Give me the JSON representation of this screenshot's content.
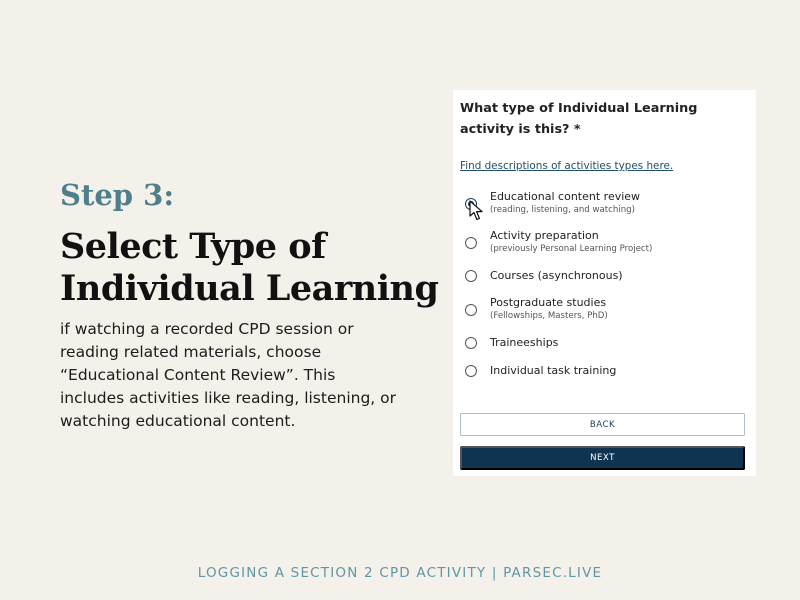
{
  "left_panel": {
    "step_label": "Step 3:",
    "title_line1": "Select Type of",
    "title_line2": "Individual Learning",
    "description": "if watching a recorded CPD session or reading related materials, choose “Educational Content Review”. This includes activities like reading, listening, or watching educational content."
  },
  "form": {
    "question": "What type of Individual Learning activity is this? *",
    "help_link": "Find descriptions of activities types here.",
    "options": [
      {
        "label": "Educational content review",
        "sublabel": "(reading, listening, and watching)",
        "selected": true
      },
      {
        "label": "Activity preparation",
        "sublabel": "(previously Personal Learning Project)",
        "selected": false
      },
      {
        "label": "Courses (asynchronous)",
        "sublabel": "",
        "selected": false
      },
      {
        "label": "Postgraduate studies",
        "sublabel": "(Fellowships, Masters, PhD)",
        "selected": false
      },
      {
        "label": "Traineeships",
        "sublabel": "",
        "selected": false
      },
      {
        "label": "Individual task training",
        "sublabel": "",
        "selected": false
      }
    ],
    "back_label": "BACK",
    "next_label": "NEXT"
  },
  "footer": {
    "text": "LOGGING A SECTION 2 CPD ACTIVITY | PARSEC.LIVE"
  },
  "colors": {
    "background": "#f4f0ea",
    "step_accent": "#4e7f8c",
    "primary_button": "#0f3451",
    "footer_text": "#5e97a6"
  },
  "icons": {
    "cursor": "mouse-pointer-icon"
  }
}
